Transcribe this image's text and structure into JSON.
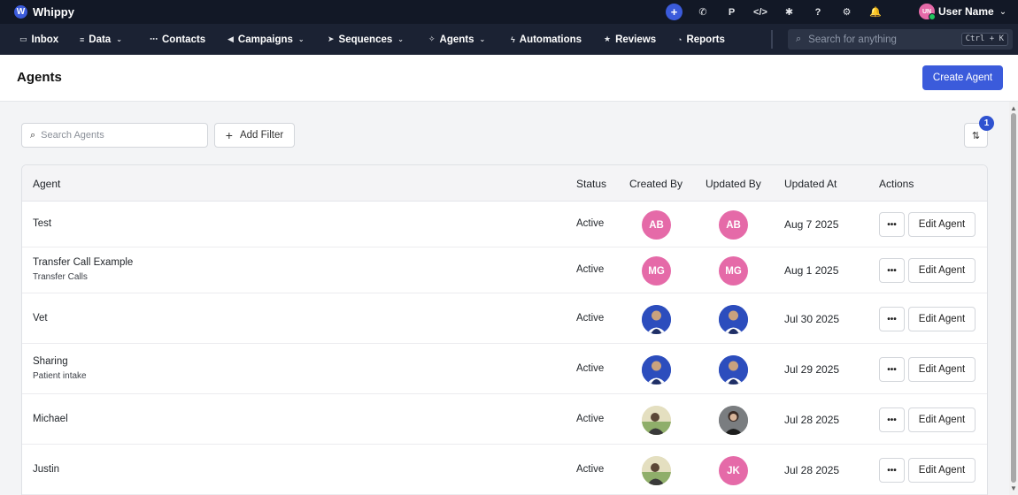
{
  "app": {
    "name": "Whippy",
    "logo_letter": "W"
  },
  "topbar": {
    "icons": [
      {
        "name": "plus-icon",
        "glyph": "+"
      },
      {
        "name": "phone-icon",
        "glyph": "✆"
      },
      {
        "name": "p-icon",
        "glyph": "P"
      },
      {
        "name": "code-icon",
        "glyph": "</>"
      },
      {
        "name": "puzzle-icon",
        "glyph": "✱"
      },
      {
        "name": "help-icon",
        "glyph": "?"
      },
      {
        "name": "gear-icon",
        "glyph": "⚙"
      },
      {
        "name": "bell-icon",
        "glyph": "🔔"
      }
    ],
    "user_initials": "UN",
    "user_name": "User Name"
  },
  "nav": {
    "items": [
      {
        "label": "Inbox",
        "icon": "inbox-icon",
        "glyph": "▭",
        "dropdown": false
      },
      {
        "label": "Data",
        "icon": "database-icon",
        "glyph": "≡",
        "dropdown": true
      },
      {
        "label": "Contacts",
        "icon": "contacts-icon",
        "glyph": "⋯",
        "dropdown": false
      },
      {
        "label": "Campaigns",
        "icon": "megaphone-icon",
        "glyph": "◀",
        "dropdown": true
      },
      {
        "label": "Sequences",
        "icon": "send-icon",
        "glyph": "➤",
        "dropdown": true
      },
      {
        "label": "Agents",
        "icon": "sparkle-icon",
        "glyph": "✧",
        "dropdown": true
      },
      {
        "label": "Automations",
        "icon": "bolt-icon",
        "glyph": "ϟ",
        "dropdown": false
      },
      {
        "label": "Reviews",
        "icon": "star-icon",
        "glyph": "★",
        "dropdown": false
      },
      {
        "label": "Reports",
        "icon": "pie-icon",
        "glyph": "◔",
        "dropdown": false
      }
    ],
    "search_placeholder": "Search for anything",
    "search_shortcut": "Ctrl + K"
  },
  "page": {
    "title": "Agents",
    "create_button": "Create Agent"
  },
  "toolbar": {
    "search_placeholder": "Search Agents",
    "add_filter": "Add Filter",
    "sort_badge": "1"
  },
  "table": {
    "columns": [
      "Agent",
      "Status",
      "Created By",
      "Updated By",
      "Updated At",
      "Actions"
    ],
    "more_label": "•••",
    "edit_label": "Edit Agent",
    "rows": [
      {
        "name": "Test",
        "sub": "",
        "status": "Active",
        "created_by": {
          "type": "initials",
          "text": "AB",
          "color": "#e56aa8"
        },
        "updated_by": {
          "type": "initials",
          "text": "AB",
          "color": "#e56aa8"
        },
        "updated_at": "Aug 7 2025"
      },
      {
        "name": "Transfer Call Example",
        "sub": "Transfer Calls",
        "status": "Active",
        "created_by": {
          "type": "initials",
          "text": "MG",
          "color": "#e56aa8"
        },
        "updated_by": {
          "type": "initials",
          "text": "MG",
          "color": "#e56aa8"
        },
        "updated_at": "Aug 1 2025"
      },
      {
        "name": "Vet",
        "sub": "",
        "status": "Active",
        "created_by": {
          "type": "photo",
          "variant": "blue"
        },
        "updated_by": {
          "type": "photo",
          "variant": "blue"
        },
        "updated_at": "Jul 30 2025"
      },
      {
        "name": "Sharing",
        "sub": "Patient intake",
        "status": "Active",
        "created_by": {
          "type": "photo",
          "variant": "blue"
        },
        "updated_by": {
          "type": "photo",
          "variant": "blue"
        },
        "updated_at": "Jul 29 2025"
      },
      {
        "name": "Michael",
        "sub": "",
        "status": "Active",
        "created_by": {
          "type": "photo",
          "variant": "field"
        },
        "updated_by": {
          "type": "photo",
          "variant": "dark"
        },
        "updated_at": "Jul 28 2025"
      },
      {
        "name": "Justin",
        "sub": "",
        "status": "Active",
        "created_by": {
          "type": "photo",
          "variant": "field"
        },
        "updated_by": {
          "type": "initials",
          "text": "JK",
          "color": "#e56aa8"
        },
        "updated_at": "Jul 28 2025"
      }
    ]
  },
  "colors": {
    "topbar_bg": "#121826",
    "navbar_bg": "#1b2233",
    "accent": "#3b5bdb",
    "avatar_pink": "#e56aa8"
  }
}
